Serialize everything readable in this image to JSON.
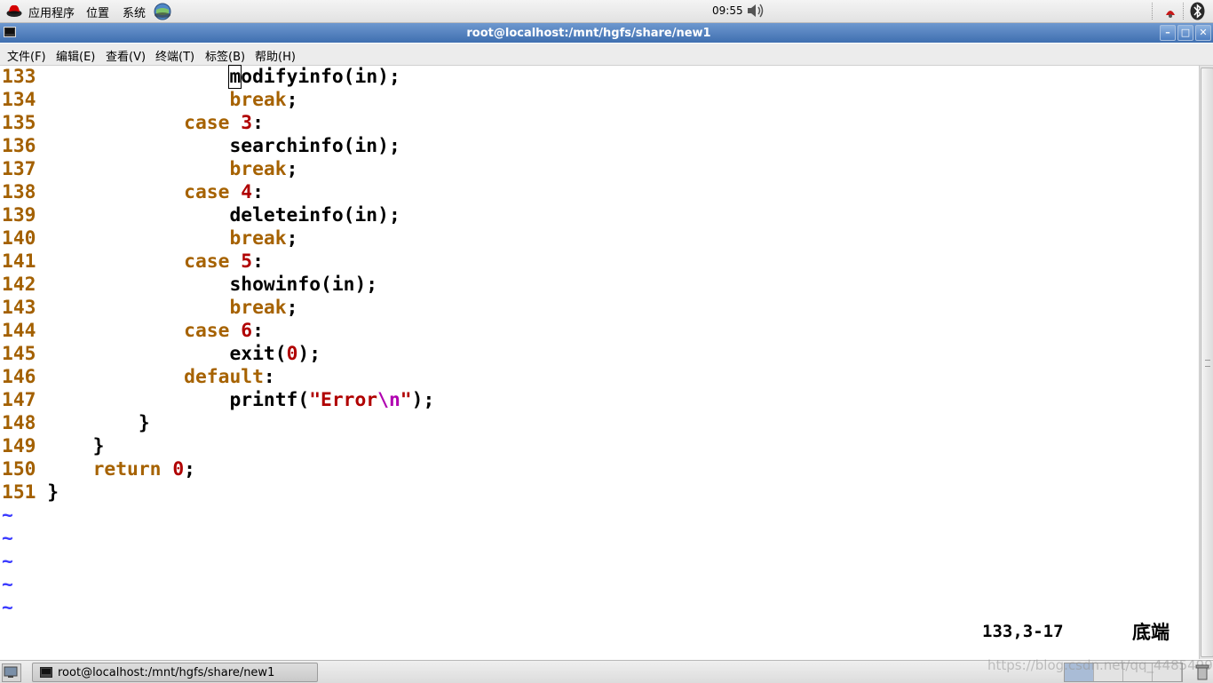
{
  "top_panel": {
    "menus": [
      "应用程序",
      "位置",
      "系统"
    ],
    "clock": "09:55"
  },
  "window": {
    "title": "root@localhost:/mnt/hgfs/share/new1",
    "controls": {
      "minimize": "–",
      "maximize": "□",
      "close": "✕"
    }
  },
  "menubar": {
    "items": [
      "文件(F)",
      "编辑(E)",
      "查看(V)",
      "终端(T)",
      "标签(B)",
      "帮助(H)"
    ]
  },
  "editor": {
    "lines": [
      {
        "n": "133",
        "code": "modifyinfo(in);"
      },
      {
        "n": "134",
        "code": "break;"
      },
      {
        "n": "135",
        "code": "case 3:"
      },
      {
        "n": "136",
        "code": "searchinfo(in);"
      },
      {
        "n": "137",
        "code": "break;"
      },
      {
        "n": "138",
        "code": "case 4:"
      },
      {
        "n": "139",
        "code": "deleteinfo(in);"
      },
      {
        "n": "140",
        "code": "break;"
      },
      {
        "n": "141",
        "code": "case 5:"
      },
      {
        "n": "142",
        "code": "showinfo(in);"
      },
      {
        "n": "143",
        "code": "break;"
      },
      {
        "n": "144",
        "code": "case 6:"
      },
      {
        "n": "145",
        "code": "exit(0);"
      },
      {
        "n": "146",
        "code": "default:"
      },
      {
        "n": "147",
        "code": "printf(\"Error\\n\");"
      },
      {
        "n": "148",
        "code": "}"
      },
      {
        "n": "149",
        "code": "}"
      },
      {
        "n": "150",
        "code": "return 0;"
      },
      {
        "n": "151",
        "code": "}"
      }
    ],
    "empty_marker": "~",
    "ruler": "133,3-17",
    "position_label": "底端"
  },
  "taskbar": {
    "task_label": "root@localhost:/mnt/hgfs/share/new1",
    "watermark": "https://blog.csdn.net/qq_44854994"
  },
  "colors": {
    "line_number": "#a36000",
    "keyword": "#a66200",
    "number": "#b00000",
    "escape": "#b000b0",
    "tilde": "#3a3aff",
    "titlebar": "#4f7fbe"
  }
}
